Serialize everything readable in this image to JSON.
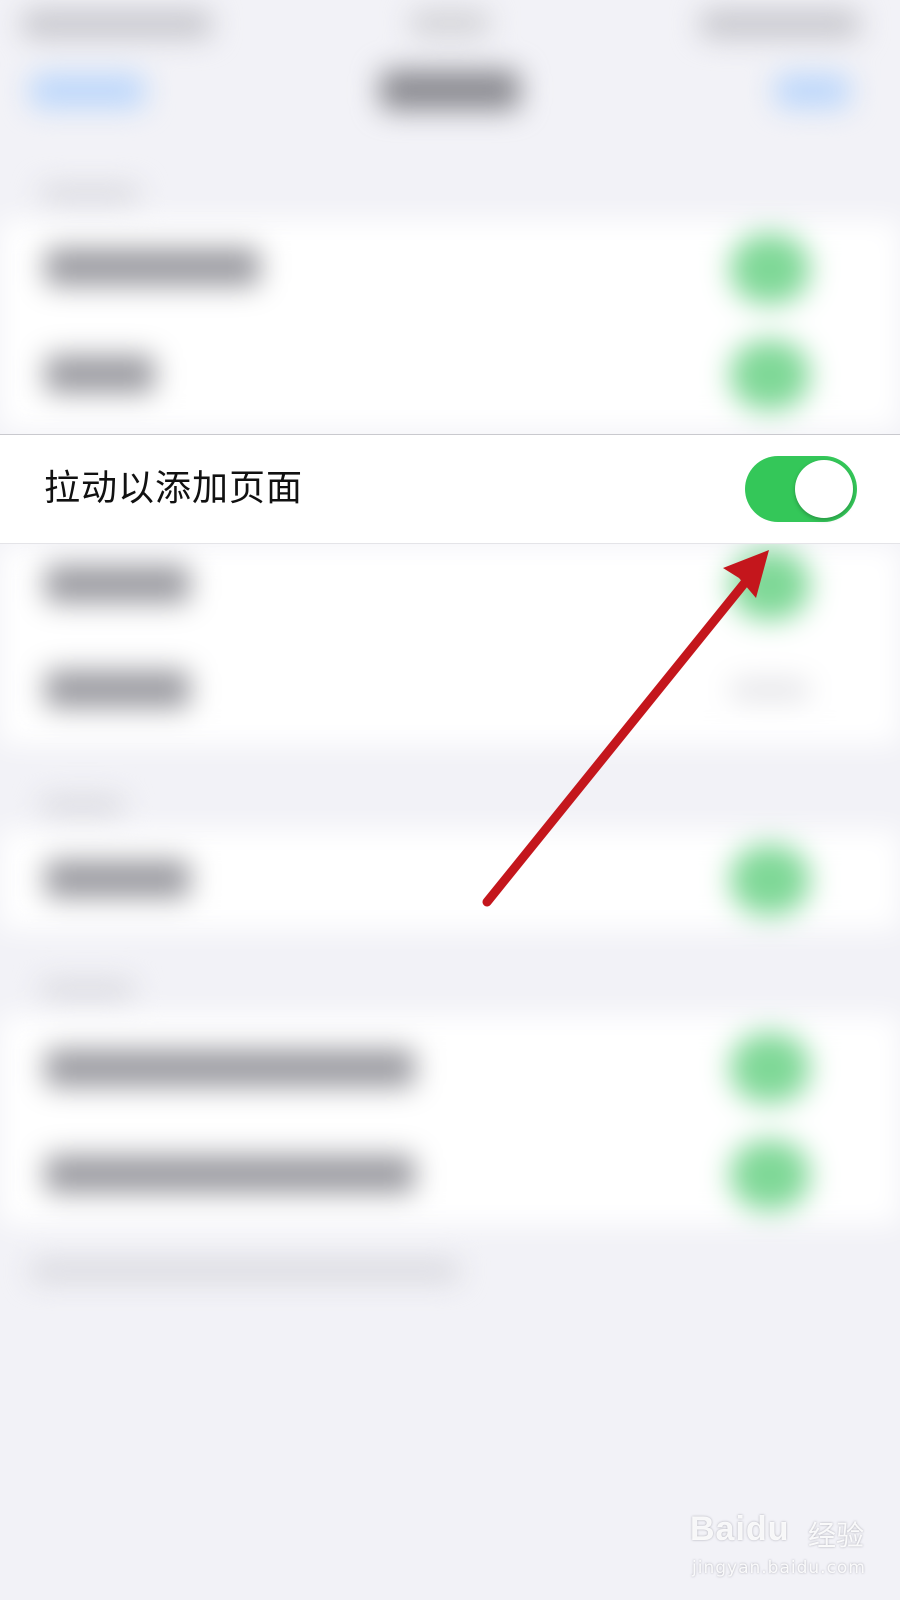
{
  "settings": {
    "focused_row": {
      "label": "拉动以添加页面",
      "toggle_on": true,
      "toggle_color": "#34c759"
    }
  },
  "annotation": {
    "arrow_color": "#c4161c"
  },
  "watermark": {
    "brand": "Baidu",
    "brand_cn": "经验",
    "url": "jingyan.baidu.com"
  },
  "colors": {
    "background": "#f2f2f7",
    "group_background": "#ffffff"
  }
}
